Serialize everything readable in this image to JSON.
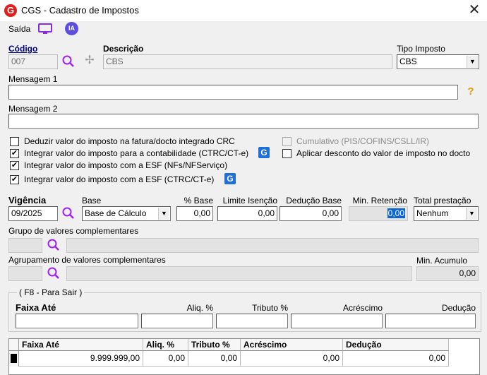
{
  "window": {
    "title": "CGS - Cadastro de Impostos",
    "app_icon": "G",
    "close": "✕"
  },
  "toolbar": {
    "exit_label": "Saída",
    "ia_label": "IA"
  },
  "codigo": {
    "label": "Código",
    "value": "007"
  },
  "descricao": {
    "label": "Descrição",
    "value": "CBS"
  },
  "tipo_imposto": {
    "label": "Tipo Imposto",
    "value": "CBS"
  },
  "mensagem1": {
    "label": "Mensagem 1",
    "value": ""
  },
  "mensagem2": {
    "label": "Mensagem 2",
    "value": ""
  },
  "checkboxes": {
    "deduzir": {
      "label": "Deduzir valor do imposto na fatura/docto integrado CRC",
      "checked": false
    },
    "contabilidade": {
      "label": "Integrar valor do imposto para a contabilidade (CTRC/CT-e)",
      "checked": true
    },
    "esf_nf": {
      "label": "Integrar valor do imposto com a ESF (NFs/NFServiço)",
      "checked": true
    },
    "esf_ctrc": {
      "label": "Integrar valor do imposto com a ESF (CTRC/CT-e)",
      "checked": true
    },
    "cumulativo": {
      "label": "Cumulativo (PIS/COFINS/CSLL/IR)",
      "checked": false,
      "disabled": true
    },
    "desconto": {
      "label": "Aplicar desconto do valor de imposto no docto",
      "checked": false
    }
  },
  "vigencia": {
    "label": "Vigência",
    "value": "09/2025"
  },
  "base": {
    "label": "Base",
    "value": "Base de Cálculo"
  },
  "pct_base": {
    "label": "% Base",
    "value": "0,00"
  },
  "limite_isencao": {
    "label": "Limite Isenção",
    "value": "0,00"
  },
  "deducao_base": {
    "label": "Dedução Base",
    "value": "0,00"
  },
  "min_retencao": {
    "label": "Min. Retenção",
    "value": "0,00"
  },
  "total_prestacao": {
    "label": "Total prestação",
    "value": "Nenhum"
  },
  "grupo_valores": {
    "label": "Grupo de valores complementares"
  },
  "agrupamento": {
    "label": "Agrupamento de valores complementares"
  },
  "min_acumulo": {
    "label": "Min. Acumulo",
    "value": "0,00"
  },
  "faixas_group": {
    "caption": "( F8 - Para Sair )",
    "faixa_ate": "Faixa Até",
    "aliq": "Aliq. %",
    "tributo": "Tributo %",
    "acrescimo": "Acréscimo",
    "deducao": "Dedução"
  },
  "grid": {
    "columns": [
      "Faixa Até",
      "Aliq. %",
      "Tributo %",
      "Acréscimo",
      "Dedução"
    ],
    "rows": [
      [
        "9.999.999,00",
        "0,00",
        "0,00",
        "0,00",
        "0,00"
      ]
    ]
  }
}
